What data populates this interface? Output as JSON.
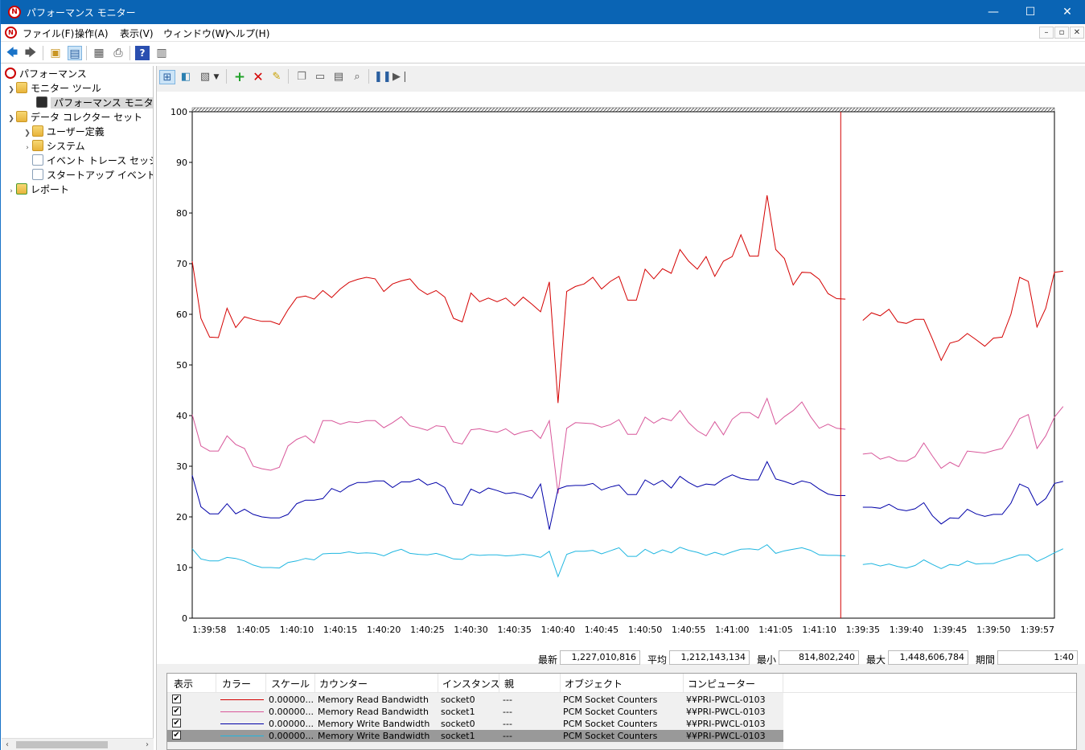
{
  "window": {
    "title": "パフォーマンス モニター",
    "minimize": "—",
    "maximize": "☐",
    "close": "✕"
  },
  "menu": {
    "items": [
      "ファイル(F)",
      "操作(A)",
      "表示(V)",
      "ウィンドウ(W)",
      "ヘルプ(H)"
    ],
    "child_controls": [
      "–",
      "▫",
      "✕"
    ]
  },
  "tree": {
    "items": [
      {
        "label": "パフォーマンス",
        "icon": "performance-icon",
        "chevron": ""
      },
      {
        "label": "モニター ツール",
        "icon": "folder-icon",
        "chevron": "down"
      },
      {
        "label": "パフォーマンス モニター",
        "icon": "monitor-chart-icon",
        "chevron": "",
        "selected": true
      },
      {
        "label": "データ コレクター セット",
        "icon": "folder-icon",
        "chevron": "down"
      },
      {
        "label": "ユーザー定義",
        "icon": "folder-icon",
        "chevron": "down"
      },
      {
        "label": "システム",
        "icon": "folder-icon",
        "chevron": "right"
      },
      {
        "label": "イベント トレース セッション",
        "icon": "document-icon",
        "chevron": ""
      },
      {
        "label": "スタートアップ イベント トレース セッション",
        "icon": "document-icon",
        "chevron": ""
      },
      {
        "label": "レポート",
        "icon": "report-icon",
        "chevron": "right"
      }
    ]
  },
  "valuebar": {
    "last_label": "最新",
    "last_value": "1,227,010,816",
    "avg_label": "平均",
    "avg_value": "1,212,143,134",
    "min_label": "最小",
    "min_value": "814,802,240",
    "max_label": "最大",
    "max_value": "1,448,606,784",
    "duration_label": "期間",
    "duration_value": "1:40"
  },
  "grid": {
    "headers": [
      "表示",
      "カラー",
      "スケール",
      "カウンター",
      "インスタンス",
      "親",
      "オブジェクト",
      "コンピューター"
    ],
    "rows": [
      {
        "show": "✔",
        "color": "#d40000",
        "scale": "0.00000...",
        "counter": "Memory Read Bandwidth",
        "instance": "socket0",
        "parent": "---",
        "object": "PCM Socket Counters",
        "computer": "¥¥PRI-PWCL-0103",
        "selected": false
      },
      {
        "show": "✔",
        "color": "#d8579a",
        "scale": "0.00000...",
        "counter": "Memory Read Bandwidth",
        "instance": "socket1",
        "parent": "---",
        "object": "PCM Socket Counters",
        "computer": "¥¥PRI-PWCL-0103",
        "selected": false
      },
      {
        "show": "✔",
        "color": "#0000a8",
        "scale": "0.00000...",
        "counter": "Memory Write Bandwidth",
        "instance": "socket0",
        "parent": "---",
        "object": "PCM Socket Counters",
        "computer": "¥¥PRI-PWCL-0103",
        "selected": false
      },
      {
        "show": "✔",
        "color": "#1fb6e0",
        "scale": "0.00000...",
        "counter": "Memory Write Bandwidth",
        "instance": "socket1",
        "parent": "---",
        "object": "PCM Socket Counters",
        "computer": "¥¥PRI-PWCL-0103",
        "selected": true
      }
    ]
  },
  "chart_data": {
    "type": "line",
    "title": "",
    "xlabel": "",
    "ylabel": "",
    "ylim": [
      0,
      100
    ],
    "yticks": [
      "0",
      "10",
      "20",
      "30",
      "40",
      "50",
      "60",
      "70",
      "80",
      "90",
      "100"
    ],
    "xtick_labels": [
      "1:39:58",
      "1:40:05",
      "1:40:10",
      "1:40:15",
      "1:40:20",
      "1:40:25",
      "1:40:30",
      "1:40:35",
      "1:40:40",
      "1:40:45",
      "1:40:50",
      "1:40:55",
      "1:41:00",
      "1:41:05",
      "1:41:10",
      "1:39:35",
      "1:39:40",
      "1:39:45",
      "1:39:50",
      "1:39:57"
    ],
    "xtick_index": [
      0,
      7,
      12,
      17,
      22,
      27,
      32,
      37,
      42,
      47,
      52,
      57,
      62,
      67,
      72,
      77,
      82,
      87,
      92,
      99
    ],
    "total_samples": 100,
    "current_index": 74,
    "grid": false,
    "cursor_color": "#d40000",
    "series": [
      {
        "color": "#d40000",
        "values": [
          70.5,
          59.2,
          55.5,
          55.4,
          61.2,
          57.4,
          59.5,
          59,
          58.6,
          58.6,
          58,
          60.9,
          63.3,
          63.6,
          63,
          64.7,
          63.3,
          65,
          66.3,
          66.9,
          67.3,
          67,
          64.5,
          66,
          66.6,
          67,
          65,
          63.9,
          64.7,
          63.4,
          59.2,
          58.5,
          64.2,
          62.5,
          63.2,
          62.5,
          63.2,
          61.7,
          63.4,
          62,
          60.5,
          66.4,
          42.5,
          64.5,
          65.5,
          66,
          67.3,
          65,
          66.5,
          67.5,
          62.8,
          62.8,
          68.9,
          67,
          69,
          68.1,
          72.8,
          70.5,
          68.9,
          71.4,
          67.5,
          70.5,
          71.4,
          75.7,
          71.5,
          71.5,
          83.5,
          72.8,
          71,
          65.8,
          68.3,
          68.2,
          66.9,
          64.1,
          63.1,
          63,
          null,
          58.8,
          60.3,
          59.7,
          61,
          58.5,
          58.2,
          59,
          59,
          55.1,
          50.9,
          54.3,
          54.8,
          56.2,
          55,
          53.7,
          55.3,
          55.5,
          60,
          67.3,
          66.5,
          57.5,
          61.2,
          68.3,
          68.5
        ]
      },
      {
        "color": "#d8579a",
        "values": [
          40.2,
          34,
          33,
          33,
          36,
          34.3,
          33.5,
          30,
          29.5,
          29.2,
          29.8,
          34,
          35.3,
          36,
          34.6,
          39,
          39,
          38.3,
          38.8,
          38.6,
          39,
          39,
          37.6,
          38.6,
          39.8,
          38,
          37.6,
          37.1,
          38,
          37.8,
          34.8,
          34.4,
          37.2,
          37.4,
          37,
          36.7,
          37.4,
          36.2,
          36.8,
          37.1,
          35.5,
          39,
          24.6,
          37.5,
          38.6,
          38.5,
          38.4,
          37.7,
          38.2,
          39.2,
          36.3,
          36.3,
          39.7,
          38.5,
          39.5,
          39,
          41,
          38.6,
          37,
          36,
          38.8,
          36.2,
          39.3,
          40.6,
          40.6,
          39.5,
          43.4,
          38.3,
          39.8,
          41,
          42.7,
          39.8,
          37.5,
          38.3,
          37.5,
          37.3,
          null,
          32.4,
          32.6,
          31.4,
          31.9,
          31.1,
          31,
          31.9,
          34.6,
          32,
          29.6,
          30.8,
          29.9,
          33,
          32.8,
          32.6,
          33.1,
          33.5,
          36.2,
          39.4,
          40.2,
          33.5,
          36,
          39.7,
          41.8
        ]
      },
      {
        "color": "#0000a8",
        "values": [
          28.2,
          22,
          20.6,
          20.6,
          22.6,
          20.6,
          21.5,
          20.5,
          20,
          19.8,
          19.8,
          20.5,
          22.6,
          23.3,
          23.3,
          23.6,
          25.6,
          24.9,
          26.1,
          26.8,
          26.8,
          27.1,
          27.1,
          25.8,
          26.9,
          26.9,
          27.5,
          26.3,
          26.8,
          25.8,
          22.6,
          22.3,
          25.5,
          24.7,
          25.7,
          25.2,
          24.6,
          24.8,
          24.4,
          23.7,
          26.5,
          17.5,
          25.5,
          26.1,
          26.2,
          26.2,
          26.6,
          25.3,
          25.9,
          26.3,
          24.4,
          24.4,
          27.3,
          26.3,
          27.2,
          25.7,
          28,
          26.8,
          25.9,
          26.5,
          26.3,
          27.5,
          28.3,
          27.6,
          27.3,
          27.3,
          30.9,
          27.5,
          27,
          26.4,
          27.1,
          26.7,
          25.5,
          24.5,
          24.2,
          24.2,
          null,
          21.9,
          21.9,
          21.7,
          22.5,
          21.5,
          21.2,
          21.6,
          22.8,
          20.2,
          18.6,
          19.8,
          19.7,
          21.5,
          20.6,
          20.1,
          20.5,
          20.5,
          22.7,
          26.5,
          25.7,
          22.3,
          23.6,
          26.6,
          27
        ]
      },
      {
        "color": "#1fb6e0",
        "values": [
          13.7,
          11.7,
          11.3,
          11.3,
          12,
          11.8,
          11.3,
          10.5,
          10,
          10,
          9.9,
          11,
          11.3,
          11.8,
          11.5,
          12.7,
          12.8,
          12.8,
          13.1,
          12.8,
          12.9,
          12.8,
          12.3,
          13.1,
          13.6,
          12.8,
          12.6,
          12.5,
          12.8,
          12.3,
          11.7,
          11.6,
          12.6,
          12.4,
          12.5,
          12.5,
          12.3,
          12.4,
          12.6,
          12.4,
          12,
          13.2,
          8.2,
          12.6,
          13.2,
          13.2,
          13.4,
          12.7,
          13.3,
          13.9,
          12.2,
          12.2,
          13.6,
          12.7,
          13.5,
          12.9,
          14,
          13.4,
          13,
          12.4,
          13,
          12.5,
          13.1,
          13.6,
          13.7,
          13.5,
          14.5,
          12.8,
          13.3,
          13.6,
          13.9,
          13.4,
          12.5,
          12.4,
          12.4,
          12.3,
          null,
          10.6,
          10.8,
          10.3,
          10.7,
          10.2,
          9.9,
          10.4,
          11.5,
          10.6,
          9.8,
          10.6,
          10.4,
          11.3,
          10.7,
          10.8,
          10.8,
          11.4,
          11.9,
          12.5,
          12.5,
          11.2,
          12,
          12.9,
          13.7
        ]
      }
    ]
  }
}
